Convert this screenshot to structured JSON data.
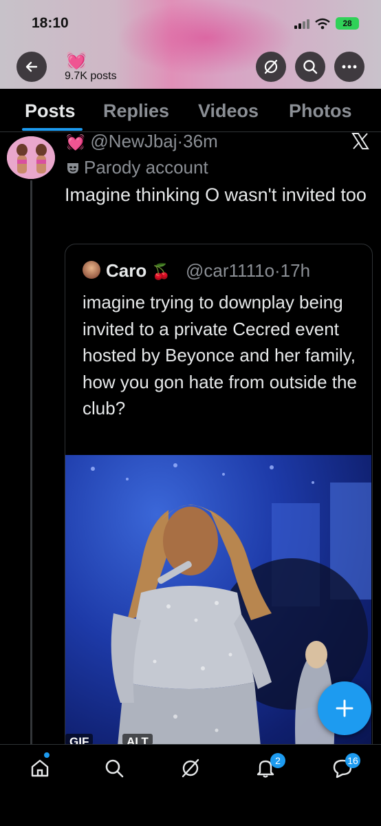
{
  "status_bar": {
    "time": "18:10",
    "battery": "28"
  },
  "header": {
    "emoji": "💓",
    "post_count": "9.7K posts",
    "icons": [
      "back-arrow-icon",
      "grok-icon",
      "search-icon",
      "more-icon"
    ]
  },
  "tabs": [
    {
      "label": "Posts",
      "active": true
    },
    {
      "label": "Replies",
      "active": false
    },
    {
      "label": "Videos",
      "active": false
    },
    {
      "label": "Photos",
      "active": false
    }
  ],
  "tweet": {
    "emoji": "💓",
    "handle_time": "@NewJbaj·36m",
    "parody_label": "Parody account",
    "text": "Imagine thinking O wasn't invited too",
    "platform_icon": "x-logo-icon"
  },
  "quote": {
    "name": "Caro",
    "name_emoji": "🍒",
    "handle_time": "@car1111o·17h",
    "text": "imagine trying to downplay being invited to a private Cecred event hosted by Beyonce and her family, how you gon hate from outside the club?",
    "media_badges": [
      "GIF",
      "ALT"
    ]
  },
  "bottom_nav": {
    "items": [
      {
        "name": "home",
        "badge": ""
      },
      {
        "name": "search",
        "badge": ""
      },
      {
        "name": "grok",
        "badge": ""
      },
      {
        "name": "notifications",
        "badge": "2"
      },
      {
        "name": "messages",
        "badge": "16"
      }
    ]
  },
  "colors": {
    "accent": "#1d9bf0",
    "background": "#000000",
    "secondary_text": "#8b8f95"
  }
}
